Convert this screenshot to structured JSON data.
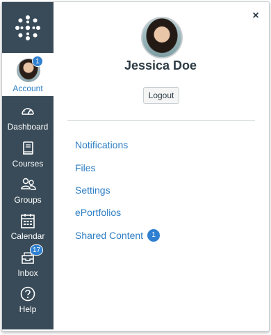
{
  "nav": {
    "account": {
      "label": "Account",
      "badge": "1"
    },
    "items": [
      {
        "label": "Dashboard",
        "icon": "dashboard-icon"
      },
      {
        "label": "Courses",
        "icon": "courses-icon"
      },
      {
        "label": "Groups",
        "icon": "groups-icon"
      },
      {
        "label": "Calendar",
        "icon": "calendar-icon"
      },
      {
        "label": "Inbox",
        "icon": "inbox-icon",
        "badge": "17"
      },
      {
        "label": "Help",
        "icon": "help-icon"
      }
    ]
  },
  "tray": {
    "close_label": "×",
    "user_name": "Jessica Doe",
    "logout_label": "Logout",
    "links": [
      {
        "label": "Notifications"
      },
      {
        "label": "Files"
      },
      {
        "label": "Settings"
      },
      {
        "label": "ePortfolios"
      },
      {
        "label": "Shared Content",
        "badge": "1"
      }
    ]
  },
  "colors": {
    "nav_background": "#394b58",
    "accent": "#2d7ec4",
    "badge": "#2f80d1"
  }
}
